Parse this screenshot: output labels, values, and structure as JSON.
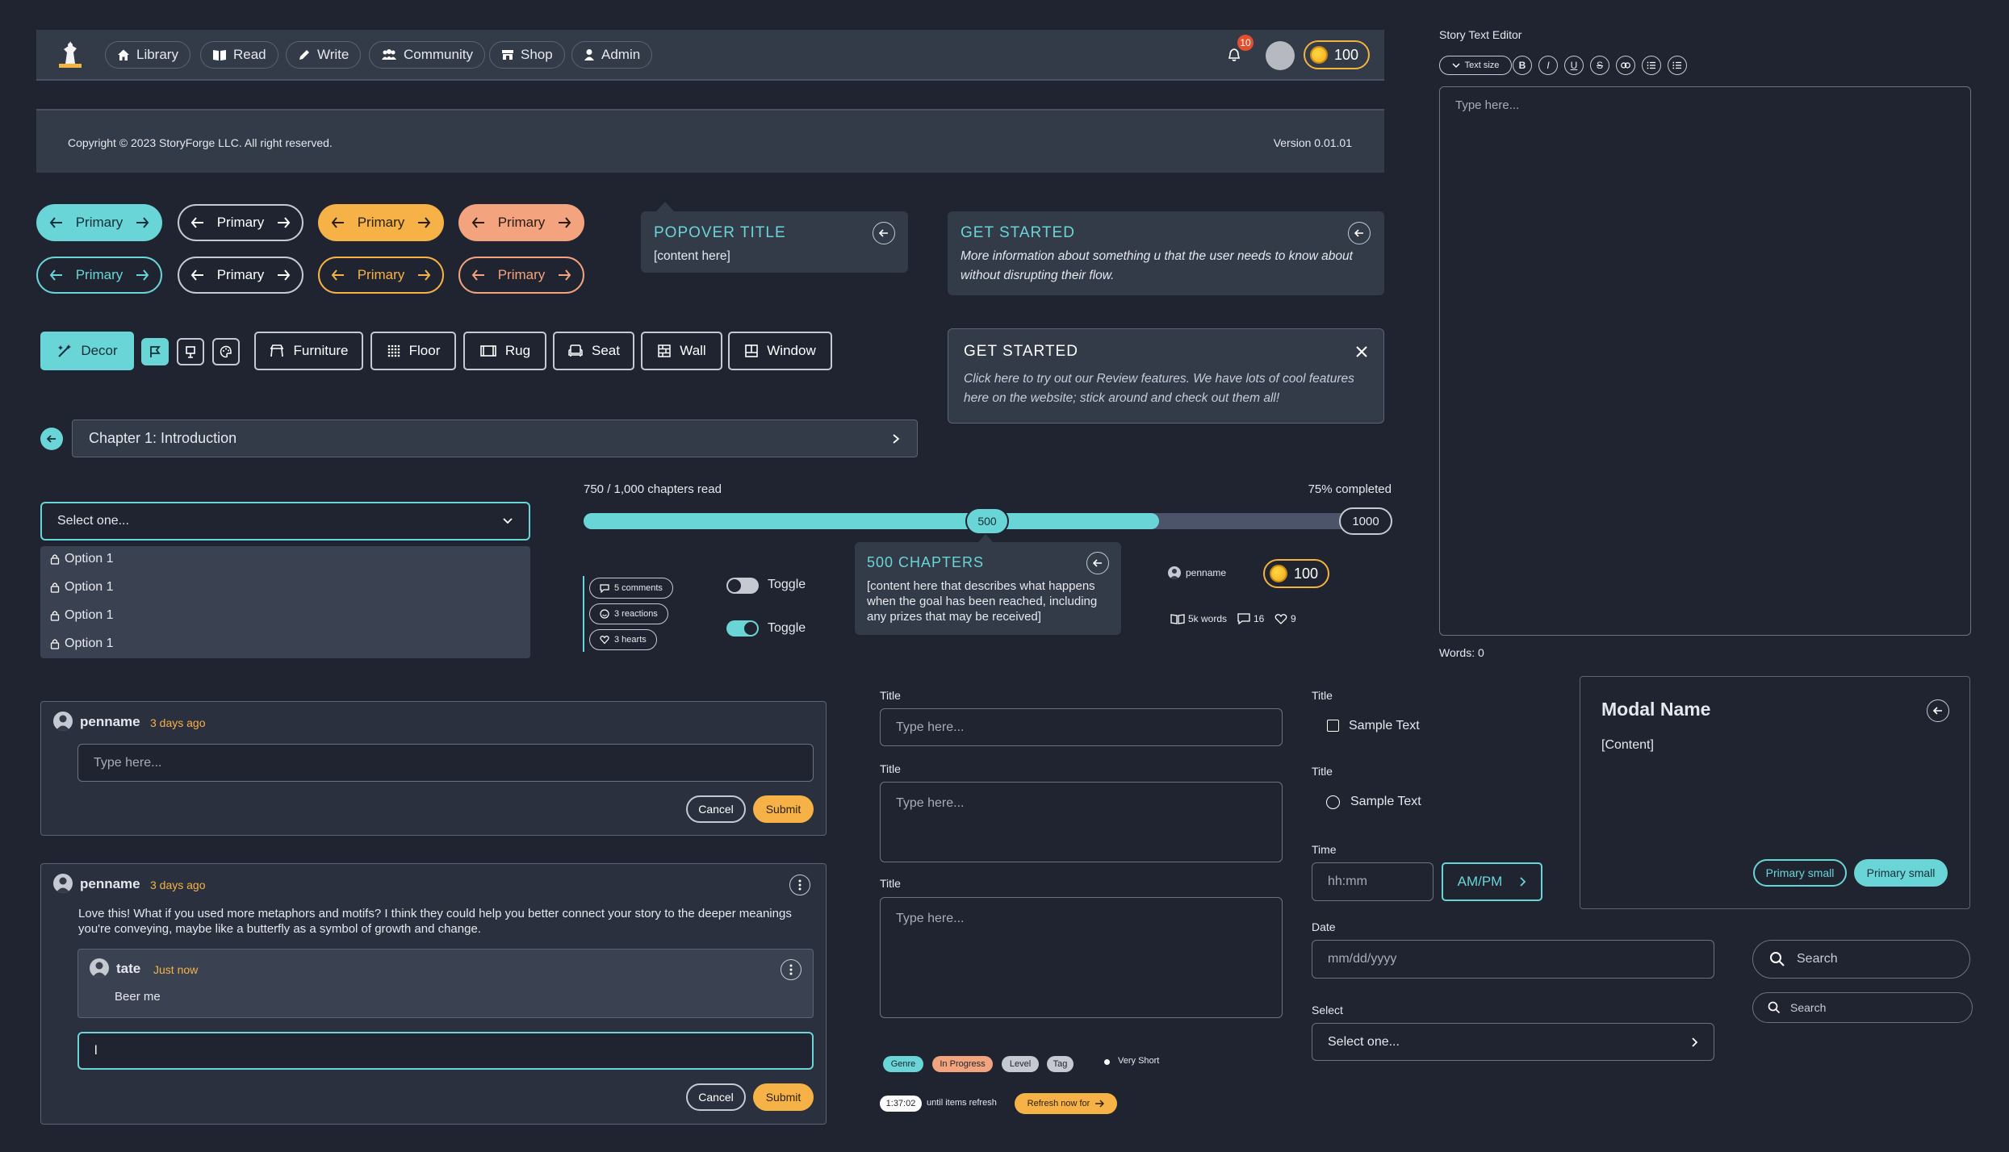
{
  "nav": {
    "items": [
      {
        "label": "Library",
        "icon": "home-icon"
      },
      {
        "label": "Read",
        "icon": "book-icon"
      },
      {
        "label": "Write",
        "icon": "pencil-icon"
      },
      {
        "label": "Community",
        "icon": "users-icon"
      },
      {
        "label": "Shop",
        "icon": "store-icon"
      },
      {
        "label": "Admin",
        "icon": "user-icon"
      }
    ],
    "notification_count": "10",
    "coins": "100"
  },
  "footer": {
    "copyright": "Copyright © 2023 StoryForge LLC. All right reserved.",
    "version": "Version 0.01.01"
  },
  "buttons": {
    "primary_label": "Primary"
  },
  "popover": {
    "title": "POPOVER TITLE",
    "content": "[content here]"
  },
  "get_started_1": {
    "title": "GET STARTED",
    "text": "More information about something u that the user needs to know about without disrupting their flow."
  },
  "get_started_2": {
    "title": "GET STARTED",
    "text": "Click here to try out our Review features. We have lots of cool features here on the website; stick around and check out them all!"
  },
  "toolbar": {
    "decor": "Decor",
    "items": [
      "Furniture",
      "Floor",
      "Rug",
      "Seat",
      "Wall",
      "Window"
    ]
  },
  "chapter": {
    "title": "Chapter 1: Introduction"
  },
  "dropdown": {
    "placeholder": "Select one...",
    "options": [
      "Option 1",
      "Option 1",
      "Option 1",
      "Option 1"
    ]
  },
  "progress": {
    "read_text": "750 / 1,000 chapters read",
    "completed_text": "75% completed",
    "fraction": 0.75,
    "marker": "500",
    "max": "1000"
  },
  "chapters_popover": {
    "title": "500 CHAPTERS",
    "text": "[content here that describes what happens when the goal has been reached, including any prizes that may be received]"
  },
  "reactions": {
    "comments": "5 comments",
    "reactions": "3 reactions",
    "hearts": "3 hearts"
  },
  "toggles": {
    "label_off": "Toggle",
    "label_on": "Toggle"
  },
  "story_stats": {
    "penname": "penname",
    "coins": "100",
    "words": "5k words",
    "comments": "16",
    "likes": "9"
  },
  "comment_box_1": {
    "author": "penname",
    "time": "3 days ago",
    "placeholder": "Type here...",
    "cancel": "Cancel",
    "submit": "Submit"
  },
  "comment_box_2": {
    "author": "penname",
    "time": "3 days ago",
    "body": "Love this! What if you used more metaphors and motifs? I think they could help you better connect your story to the deeper meanings you're conveying, maybe like a butterfly as a symbol of growth and change.",
    "reply_author": "tate",
    "reply_time": "Just now",
    "reply_body": "Beer me",
    "input_value": "l",
    "cancel": "Cancel",
    "submit": "Submit"
  },
  "forms": {
    "title_label": "Title",
    "placeholder": "Type here..."
  },
  "tags": {
    "genre": "Genre",
    "in_progress": "In Progress",
    "level": "Level",
    "tag": "Tag",
    "very_short": "Very Short",
    "timer": "1:37:02",
    "until_refresh": "until items refresh",
    "refresh_button": "Refresh now for"
  },
  "controls": {
    "title_label": "Title",
    "checkbox_label": "Sample Text",
    "radio_label": "Sample Text",
    "time_label": "Time",
    "time_placeholder": "hh:mm",
    "ampm": "AM/PM",
    "date_label": "Date",
    "date_placeholder": "mm/dd/yyyy",
    "select_label": "Select",
    "select_placeholder": "Select one..."
  },
  "editor": {
    "title": "Story Text Editor",
    "text_size": "Text size",
    "placeholder": "Type here...",
    "words": "Words: 0"
  },
  "modal": {
    "name": "Modal Name",
    "content": "[Content]",
    "btn_outline": "Primary small",
    "btn_filled": "Primary small"
  },
  "search": {
    "placeholder_lg": "Search",
    "placeholder_sm": "Search"
  },
  "colors": {
    "teal": "#6ad5d6",
    "orange": "#f6b247",
    "salmon": "#f3a37d",
    "background": "#1f2430",
    "surface": "#333a48"
  }
}
